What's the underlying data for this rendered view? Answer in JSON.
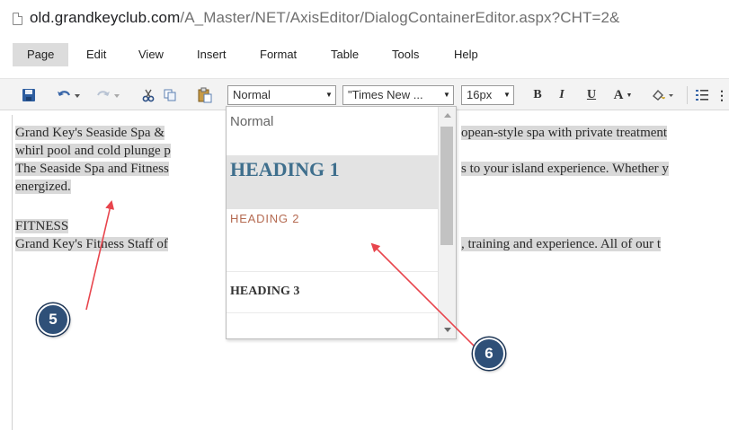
{
  "browser": {
    "url_domain": "old.grandkeyclub.com",
    "url_path": "/A_Master/NET/AxisEditor/DialogContainerEditor.aspx?CHT=2&"
  },
  "menu": {
    "items": [
      "Page",
      "Edit",
      "View",
      "Insert",
      "Format",
      "Table",
      "Tools",
      "Help"
    ],
    "active": "Page"
  },
  "toolbar": {
    "format_select": "Normal",
    "font_select": "\"Times New ...",
    "size_select": "16px",
    "bold": "B",
    "italic": "I",
    "underline": "U",
    "font_color": "A",
    "icons": [
      "save-icon",
      "undo-icon",
      "redo-icon",
      "cut-icon",
      "copy-icon",
      "paste-icon",
      "highlight-icon",
      "list-icon"
    ]
  },
  "editor": {
    "lines": [
      {
        "left": "Grand Key's Seaside Spa &",
        "right": "opean-style spa with private treatment"
      },
      {
        "left": "whirl pool and cold plunge p",
        "right": ""
      },
      {
        "left": "The Seaside Spa and Fitness",
        "right": "s to your island experience. Whether y"
      },
      {
        "left": "energized.",
        "right": ""
      },
      {
        "left": "",
        "right": ""
      },
      {
        "left": "FITNESS",
        "right": ""
      },
      {
        "left": "Grand Key's Fitness Staff of",
        "right": ", training and experience. All of our t"
      }
    ]
  },
  "dropdown": {
    "items": [
      {
        "label": "Normal",
        "style": "normal"
      },
      {
        "label": "HEADING 1",
        "style": "h1"
      },
      {
        "label": "HEADING 2",
        "style": "h2"
      },
      {
        "label": "HEADING 3",
        "style": "h3"
      }
    ],
    "selected": "HEADING 1"
  },
  "annotations": {
    "badge_5": "5",
    "badge_6": "6",
    "arrow_color": "#e8454d"
  }
}
